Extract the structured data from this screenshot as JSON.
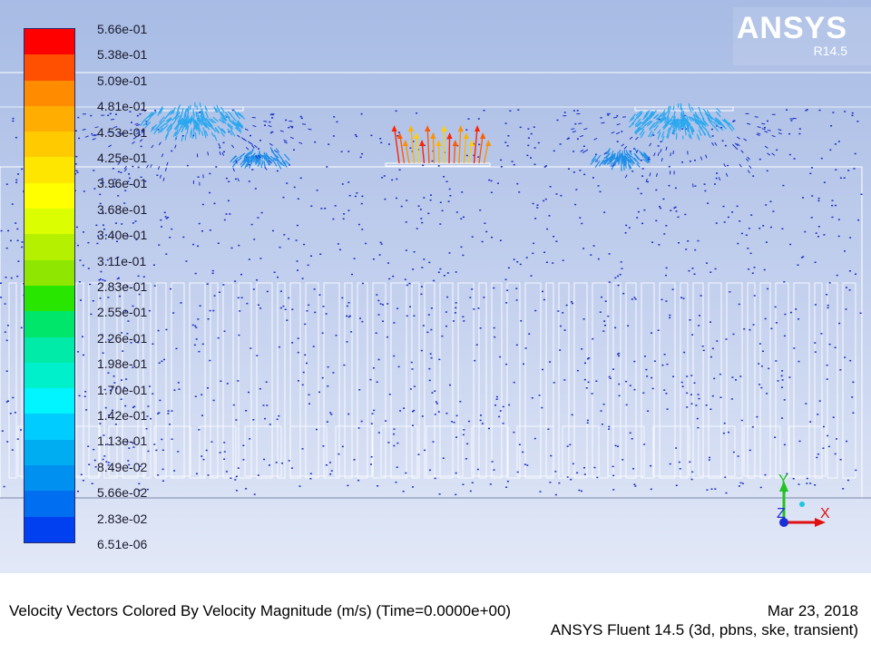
{
  "logo": {
    "name": "ANSYS",
    "version": "R14.5"
  },
  "colorbar": {
    "labels": [
      "5.66e-01",
      "5.38e-01",
      "5.09e-01",
      "4.81e-01",
      "4.53e-01",
      "4.25e-01",
      "3.96e-01",
      "3.68e-01",
      "3.40e-01",
      "3.11e-01",
      "2.83e-01",
      "2.55e-01",
      "2.26e-01",
      "1.98e-01",
      "1.70e-01",
      "1.42e-01",
      "1.13e-01",
      "8.49e-02",
      "5.66e-02",
      "2.83e-02",
      "6.51e-06"
    ],
    "colors": [
      "#ff0000",
      "#ff4f00",
      "#ff8c00",
      "#ffad00",
      "#ffcb00",
      "#ffe600",
      "#ffff00",
      "#dbff00",
      "#b4f000",
      "#8fe600",
      "#29e600",
      "#00e66b",
      "#00eba7",
      "#00f0cc",
      "#00f5ff",
      "#00ccff",
      "#00adf0",
      "#0090f0",
      "#006ef0",
      "#0040f0"
    ]
  },
  "triad": {
    "y": "Y",
    "z": "Z",
    "x": "X"
  },
  "footer": {
    "title": "Velocity Vectors Colored By Velocity Magnitude (m/s)  (Time=0.0000e+00)",
    "date": "Mar 23, 2018",
    "solver": "ANSYS Fluent 14.5 (3d, pbns, ske, transient)"
  }
}
